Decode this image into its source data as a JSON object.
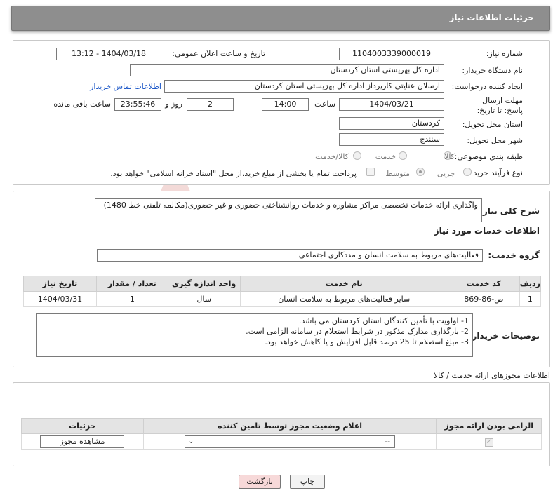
{
  "header": {
    "title": "جزئیات اطلاعات نیاز"
  },
  "form": {
    "need_number_label": "شماره نیاز:",
    "need_number": "1104003339000019",
    "announce_label": "تاریخ و ساعت اعلان عمومی:",
    "announce_value": "1404/03/18 - 13:12",
    "buyer_org_label": "نام دستگاه خریدار:",
    "buyer_org": "اداره کل بهزیستی استان کردستان",
    "creator_label": "ایجاد کننده درخواست:",
    "creator": "ارسلان  عنایتی کارپرداز اداره کل بهزیستی استان کردستان",
    "contact_link": "اطلاعات تماس خریدار",
    "deadline_label": "مهلت ارسال پاسخ: تا تاریخ:",
    "deadline_date": "1404/03/21",
    "time_label": "ساعت",
    "deadline_time": "14:00",
    "days_value": "2",
    "days_label": "روز و",
    "remaining_time": "23:55:46",
    "remaining_label": "ساعت باقی مانده",
    "province_label": "استان محل تحویل:",
    "province": "کردستان",
    "city_label": "شهر محل تحویل:",
    "city": "سنندج",
    "category_label": "طبقه بندی موضوعی:",
    "category_options": [
      "کالا",
      "خدمت",
      "کالا/خدمت"
    ],
    "process_label": "نوع فرآیند خرید :",
    "process_options": [
      "جزیی",
      "متوسط"
    ],
    "payment_note": "پرداخت تمام یا بخشی از مبلغ خرید،از محل \"اسناد خزانه اسلامی\" خواهد بود."
  },
  "summary": {
    "label": "شرح کلی نیاز:",
    "text": "واگذاری ارائه خدمات تخصصی مراکز مشاوره و خدمات روانشناختی حضوری و غیر حضوری(مکالمه تلفنی خط 1480)"
  },
  "services": {
    "section_title": "اطلاعات خدمات مورد نیاز",
    "group_label": "گروه خدمت:",
    "group_value": "فعالیت‌های مربوط به سلامت انسان و مددکاری اجتماعی",
    "columns": [
      "ردیف",
      "کد خدمت",
      "نام خدمت",
      "واحد اندازه گیری",
      "تعداد / مقدار",
      "تاریخ نیاز"
    ],
    "rows": [
      [
        "1",
        "ص-86-869",
        "سایر فعالیت‌های مربوط به سلامت انسان",
        "سال",
        "1",
        "1404/03/31"
      ]
    ]
  },
  "buyer_notes": {
    "label": "توضیحات خریدار:",
    "lines": [
      "1- اولویت با تأمین کنندگان استان کردستان می باشد.",
      "2- بارگذاری مدارک مذکور در شرایط استعلام در سامانه الزامی است.",
      "3- مبلغ استعلام تا 25 درصد قابل افزایش و یا کاهش خواهد بود."
    ]
  },
  "permits": {
    "section_title": "اطلاعات مجوزهای ارائه خدمت / کالا",
    "columns": [
      "الزامی بودن ارائه مجوز",
      "اعلام وضعیت مجوز توسط تامین کننده",
      "جزئیات"
    ],
    "select_value": "--",
    "view_button": "مشاهده مجوز"
  },
  "footer": {
    "print_button": "چاپ",
    "back_button": "بازگشت"
  },
  "watermark": {
    "text": "AriaTender.neT"
  },
  "colors": {
    "header_bg": "#8e8e8e",
    "link": "#1a56c7",
    "back_button_bg": "#f7d9d9",
    "watermark": "#c0392b"
  }
}
